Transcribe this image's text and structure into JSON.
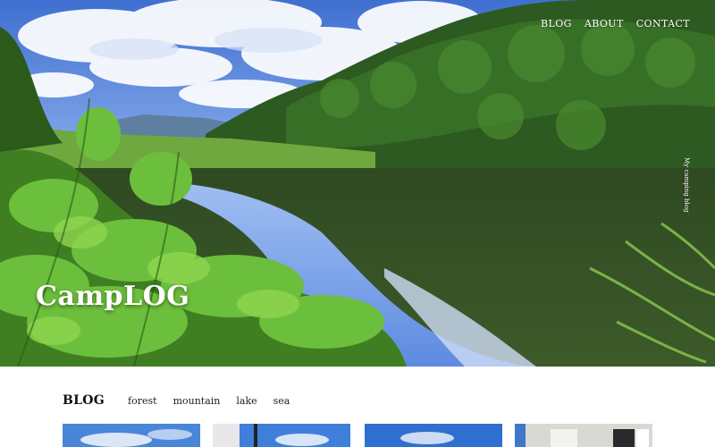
{
  "header": {
    "nav": [
      {
        "label": "BLOG"
      },
      {
        "label": "ABOUT"
      },
      {
        "label": "CONTACT"
      }
    ]
  },
  "hero": {
    "title": "CampLOG",
    "tagline": "My camping blog",
    "image": "lake-forest-photo"
  },
  "blog": {
    "heading": "BLOG",
    "categories": [
      "forest",
      "mountain",
      "lake",
      "sea"
    ],
    "thumbnails": [
      {
        "image": "sky-clouds-photo"
      },
      {
        "image": "building-sky-photo"
      },
      {
        "image": "blue-sky-photo"
      },
      {
        "image": "house-photo"
      }
    ]
  },
  "colors": {
    "sky": "#4f7fd6",
    "forest": "#2f5e23",
    "foliage": "#5aa83a",
    "water": "#3a5a2c",
    "text_dark": "#111111",
    "text_light": "#ffffff"
  }
}
